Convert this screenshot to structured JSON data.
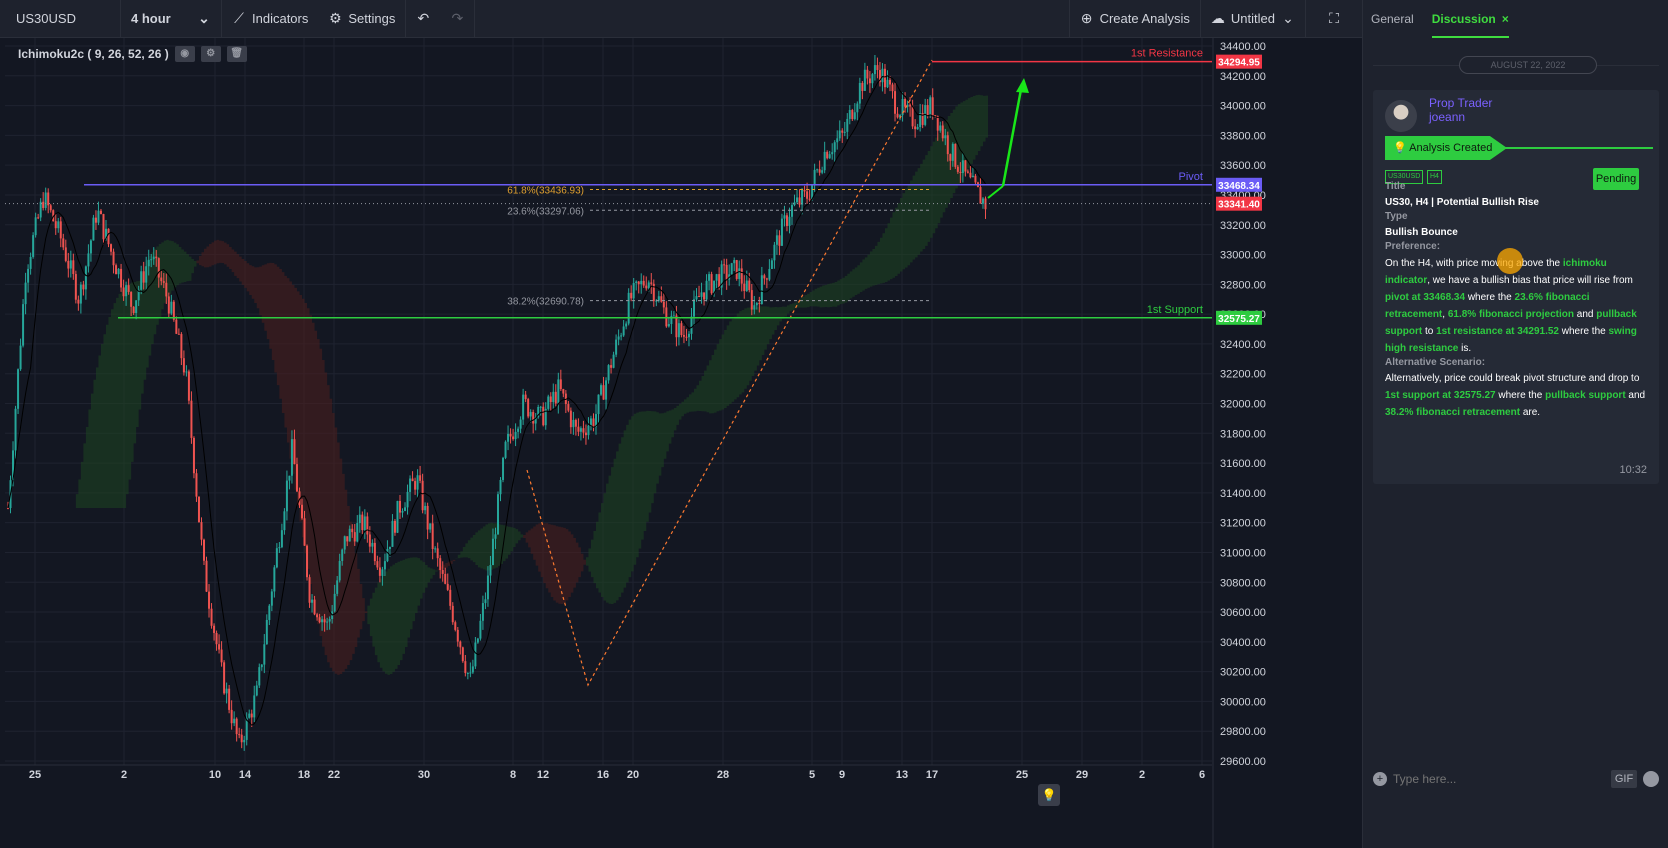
{
  "toolbar": {
    "symbol": "US30USD",
    "interval": "4 hour",
    "indicators": "Indicators",
    "settings": "Settings",
    "create_analysis": "Create Analysis",
    "layout_name": "Untitled"
  },
  "legend": {
    "indicator": "Ichimoku2c ( 9, 26, 52, 26 )"
  },
  "chart_data": {
    "type": "candlestick",
    "symbol": "US30USD",
    "interval": "4 hour",
    "y_ticks": [
      34400,
      34200,
      34000,
      33800,
      33600,
      33400,
      33200,
      33000,
      32800,
      32600,
      32400,
      32200,
      32000,
      31800,
      31600,
      31400,
      31200,
      31000,
      30800,
      30600,
      30400,
      30200,
      30000,
      29800,
      29600
    ],
    "y_range": [
      29600,
      34420
    ],
    "x_ticks": [
      "25",
      "2",
      "10",
      "14",
      "18",
      "22",
      "30",
      "8",
      "12",
      "16",
      "20",
      "28",
      "5",
      "9",
      "13",
      "17",
      "25",
      "29",
      "2",
      "6"
    ],
    "price_path": [
      31300,
      32900,
      33390,
      33100,
      32700,
      33300,
      32950,
      32650,
      33000,
      32700,
      32200,
      30900,
      30200,
      29700,
      30050,
      30900,
      31700,
      30700,
      30500,
      31100,
      31200,
      30900,
      31300,
      31500,
      31000,
      30600,
      30130,
      30800,
      31700,
      32000,
      31900,
      32100,
      31800,
      31900,
      32300,
      32700,
      32850,
      32600,
      32450,
      32750,
      32850,
      32900,
      32650,
      33000,
      33300,
      33400,
      33700,
      33800,
      34150,
      34250,
      34000,
      33900,
      34000,
      33700,
      33500,
      33341
    ],
    "levels": [
      {
        "name": "1st Resistance",
        "value": 34294.95,
        "label": "34294.95",
        "color": "#f23645"
      },
      {
        "name": "Pivot",
        "value": 33468.34,
        "label": "33468.34",
        "color": "#6b5cf6"
      },
      {
        "name": "1st Support",
        "value": 32575.27,
        "label": "32575.27",
        "color": "#2ecc40"
      }
    ],
    "current_price": {
      "value": 33341.4,
      "label": "33341.40",
      "color": "#f23645"
    },
    "fibonacci": [
      {
        "label": "61.8%(33436.93)",
        "value": 33436.93,
        "color": "#e0a030"
      },
      {
        "label": "23.6%(33297.06)",
        "value": 33297.06,
        "color": "#9598a1"
      },
      {
        "label": "38.2%(32690.78)",
        "value": 32690.78,
        "color": "#9598a1"
      }
    ],
    "colors": {
      "up": "#26a69a",
      "down": "#ef5350",
      "cloud_bull": "#1e4620",
      "cloud_bear": "#4a1e1e",
      "arrow": "#19e619"
    }
  },
  "panel": {
    "tab_general": "General",
    "tab_discussion": "Discussion",
    "tab_close": "×",
    "date": "AUGUST 22, 2022",
    "card": {
      "role": "Prop Trader",
      "user": "joeann",
      "status_banner": "Analysis Created",
      "tag_symbol": "US30USD",
      "tag_tf": "H4",
      "status": "Pending",
      "title_label": "Title",
      "title": "US30, H4 | Potential Bullish Rise",
      "type_label": "Type",
      "type": "Bullish Bounce",
      "pref_label": "Preference:",
      "pref_parts": [
        "On the H4, with price moving above the ",
        "ichimoku indicator",
        ", we have a bullish bias that price will rise from ",
        "pivot at 33468.34",
        " where the ",
        "23.6% fibonacci retracement",
        ", ",
        "61.8% fibonacci projection",
        " and ",
        "pullback support",
        " to ",
        "1st resistance at 34291.52",
        " where the ",
        "swing high resistance",
        " is."
      ],
      "alt_label": "Alternative Scenario:",
      "alt_parts": [
        "Alternatively, price could break pivot structure and drop to ",
        "1st support at 32575.27",
        " where the ",
        "pullback support",
        " and ",
        "38.2% fibonacci retracement",
        " are."
      ],
      "time": "10:32"
    },
    "composer_placeholder": "Type here...",
    "gif_label": "GIF"
  }
}
